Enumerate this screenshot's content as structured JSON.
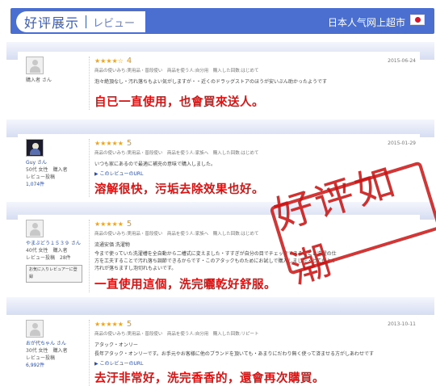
{
  "header": {
    "tab_title": "好评展示",
    "tab_subtitle": "レビュー",
    "shop_name": "日本人气网上超市"
  },
  "stamp_text": "好评如潮",
  "reviews": [
    {
      "user": "購入者 さん",
      "stars": "★★★★☆",
      "rating": "4",
      "date": "2015-06-24",
      "meta": "商品の使いみち:実用品・普段使い　商品を使う人:自分用　購入した回数:はじめて",
      "body": "泡々絶頂なし・汚れ落ちもよい気がしますが・・近くのドラッグストアのほうが安いぶん助かったようです",
      "caption": "自已一直使用，也會買來送人。"
    },
    {
      "user": "Guy さん",
      "user_lines": [
        "50代 女性　購入者",
        "レビュー投稿",
        "1,074件"
      ],
      "stars": "★★★★★",
      "rating": "5",
      "date": "2015-01-29",
      "meta": "商品の使いみち:実用品・普段使い　商品を使う人:家族へ　購入した回数:はじめて",
      "body": "いつも家にあるので最適に補充の意味で購入しました。",
      "link": "▶ このレビューのURL",
      "caption": "溶解很快，污垢去除效果也好。"
    },
    {
      "user": "やまぶどう１５３９ さん",
      "user_lines": [
        "40代 女性　購入者",
        "レビュー投稿　28件"
      ],
      "user_button": "お気に入りレビュアーに登録",
      "stars": "★★★★★",
      "rating": "5",
      "date": "",
      "meta": "商品の使いみち:実用品・普段使い　商品を使う人:家族へ　購入した回数:はじめて",
      "body_title": "流通安価 洗濯物",
      "body": "今まで使っていた洗濯槽を全自動から二槽式に変えました・すすぎが自分の目でチェックできることと洗濯の仕方を工夫することで汚れ落ち調節できるからです・このアタックものためにお試しで購入しました・とてもよく汚れが落ちますし泡切れもよいです。",
      "caption": "一直使用這個，洗完曬乾好舒服。"
    },
    {
      "user": "おが代ちゃん さん",
      "user_lines": [
        "30代 女性　購入者",
        "レビュー投稿",
        "6,992件"
      ],
      "stars": "★★★★★",
      "rating": "5",
      "date": "2013-10-11",
      "meta": "商品の使いみち:実用品・普段使い　商品を使う人:自分用　購入した回数:リピート",
      "body_title": "アタック・オンリー",
      "body": "長年アタック・オンリーです。お手元やお客様に他のブランドを頂いても・あまりにだわり無く使って済ませる方がしあわせです",
      "link": "▶ このレビューのURL",
      "caption": "去汙非常好，洗完香香的，還會再次購買。"
    }
  ]
}
